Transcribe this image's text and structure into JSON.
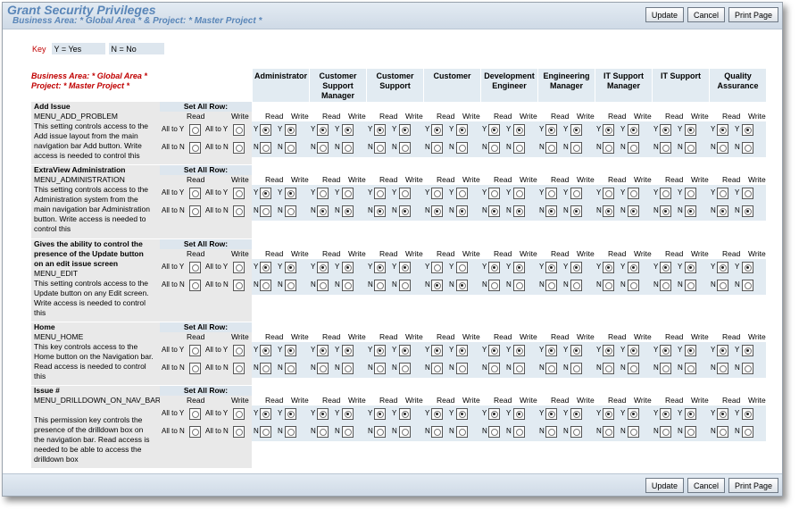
{
  "header": {
    "title": "Grant Security Privileges",
    "subtitle": "Business Area: * Global Area * & Project: * Master Project *"
  },
  "buttons": {
    "update": "Update",
    "cancel": "Cancel",
    "print": "Print Page"
  },
  "key": {
    "label": "Key",
    "yes": "Y = Yes",
    "no": "N = No"
  },
  "grid": {
    "header_lead_line1": "Business Area: * Global Area *",
    "header_lead_line2": "Project: * Master Project *",
    "set_all_label": "Set All Row:",
    "read_label": "Read",
    "write_label": "Write",
    "all_to_y": "All to Y",
    "all_to_n": "All to N",
    "y": "Y",
    "n": "N",
    "roles": [
      {
        "l1": "Administrator",
        "l2": "",
        "l3": ""
      },
      {
        "l1": "Customer",
        "l2": "Support",
        "l3": "Manager"
      },
      {
        "l1": "Customer",
        "l2": "Support",
        "l3": ""
      },
      {
        "l1": "Customer",
        "l2": "",
        "l3": ""
      },
      {
        "l1": "Development",
        "l2": "Engineer",
        "l3": ""
      },
      {
        "l1": "Engineering",
        "l2": "Manager",
        "l3": ""
      },
      {
        "l1": "IT Support",
        "l2": "Manager",
        "l3": ""
      },
      {
        "l1": "IT Support",
        "l2": "",
        "l3": ""
      },
      {
        "l1": "Quality",
        "l2": "Assurance",
        "l3": ""
      }
    ],
    "sections": [
      {
        "title": "Add Issue",
        "title2": "",
        "title3": "",
        "key": "MENU_ADD_PROBLEM",
        "desc": [
          "This setting controls access to the",
          "Add issue layout from the main",
          "navigation bar Add button. Write",
          "access is needed to control this"
        ],
        "perms": [
          [
            "Y",
            "Y"
          ],
          [
            "Y",
            "Y"
          ],
          [
            "Y",
            "Y"
          ],
          [
            "Y",
            "Y"
          ],
          [
            "Y",
            "Y"
          ],
          [
            "Y",
            "Y"
          ],
          [
            "Y",
            "Y"
          ],
          [
            "Y",
            "Y"
          ],
          [
            "Y",
            "Y"
          ]
        ]
      },
      {
        "title": "ExtraView Administration",
        "title2": "",
        "title3": "",
        "key": "MENU_ADMINISTRATION",
        "desc": [
          "This setting controls access to the",
          "Administration system from the",
          "main navigation bar Administration",
          "button. Write access is needed to",
          "control this"
        ],
        "perms": [
          [
            "Y",
            "Y"
          ],
          [
            "N",
            "N"
          ],
          [
            "N",
            "N"
          ],
          [
            "N",
            "N"
          ],
          [
            "N",
            "N"
          ],
          [
            "N",
            "N"
          ],
          [
            "N",
            "N"
          ],
          [
            "N",
            "N"
          ],
          [
            "N",
            "N"
          ]
        ]
      },
      {
        "title": "Gives the ability to control the",
        "title2": "presence of the Update button",
        "title3": "on an edit issue screen",
        "key": "MENU_EDIT",
        "desc": [
          "This setting controls access to the",
          "Update button on any Edit screen.",
          "Write access is needed to control",
          "this"
        ],
        "perms": [
          [
            "Y",
            "Y"
          ],
          [
            "Y",
            "Y"
          ],
          [
            "Y",
            "Y"
          ],
          [
            "N",
            "N"
          ],
          [
            "Y",
            "Y"
          ],
          [
            "Y",
            "Y"
          ],
          [
            "Y",
            "Y"
          ],
          [
            "Y",
            "Y"
          ],
          [
            "Y",
            "Y"
          ]
        ]
      },
      {
        "title": "Home",
        "title2": "",
        "title3": "",
        "key": "MENU_HOME",
        "desc": [
          "This key controls access to the",
          "Home button on the Navigation bar.",
          "Read access is needed to control",
          "this"
        ],
        "perms": [
          [
            "Y",
            "Y"
          ],
          [
            "Y",
            "Y"
          ],
          [
            "Y",
            "Y"
          ],
          [
            "Y",
            "Y"
          ],
          [
            "Y",
            "Y"
          ],
          [
            "Y",
            "Y"
          ],
          [
            "Y",
            "Y"
          ],
          [
            "Y",
            "Y"
          ],
          [
            "Y",
            "Y"
          ]
        ]
      },
      {
        "title": "Issue #",
        "title2": "",
        "title3": "",
        "key": "MENU_DRILLDOWN_ON_NAV_BAR",
        "desc": [
          "",
          "This permission key controls the",
          "presence of the drilldown box on",
          "the navigation bar. Read access is",
          "needed to be able to access the",
          "drilldown box"
        ],
        "perms": [
          [
            "Y",
            "Y"
          ],
          [
            "Y",
            "Y"
          ],
          [
            "Y",
            "Y"
          ],
          [
            "Y",
            "Y"
          ],
          [
            "Y",
            "Y"
          ],
          [
            "Y",
            "Y"
          ],
          [
            "Y",
            "Y"
          ],
          [
            "Y",
            "Y"
          ],
          [
            "Y",
            "Y"
          ]
        ]
      }
    ]
  },
  "colors": {
    "title": "#5a86b8",
    "red": "#c00000",
    "cell_blue": "#e2ebf2",
    "gray": "#e9e9e9"
  }
}
